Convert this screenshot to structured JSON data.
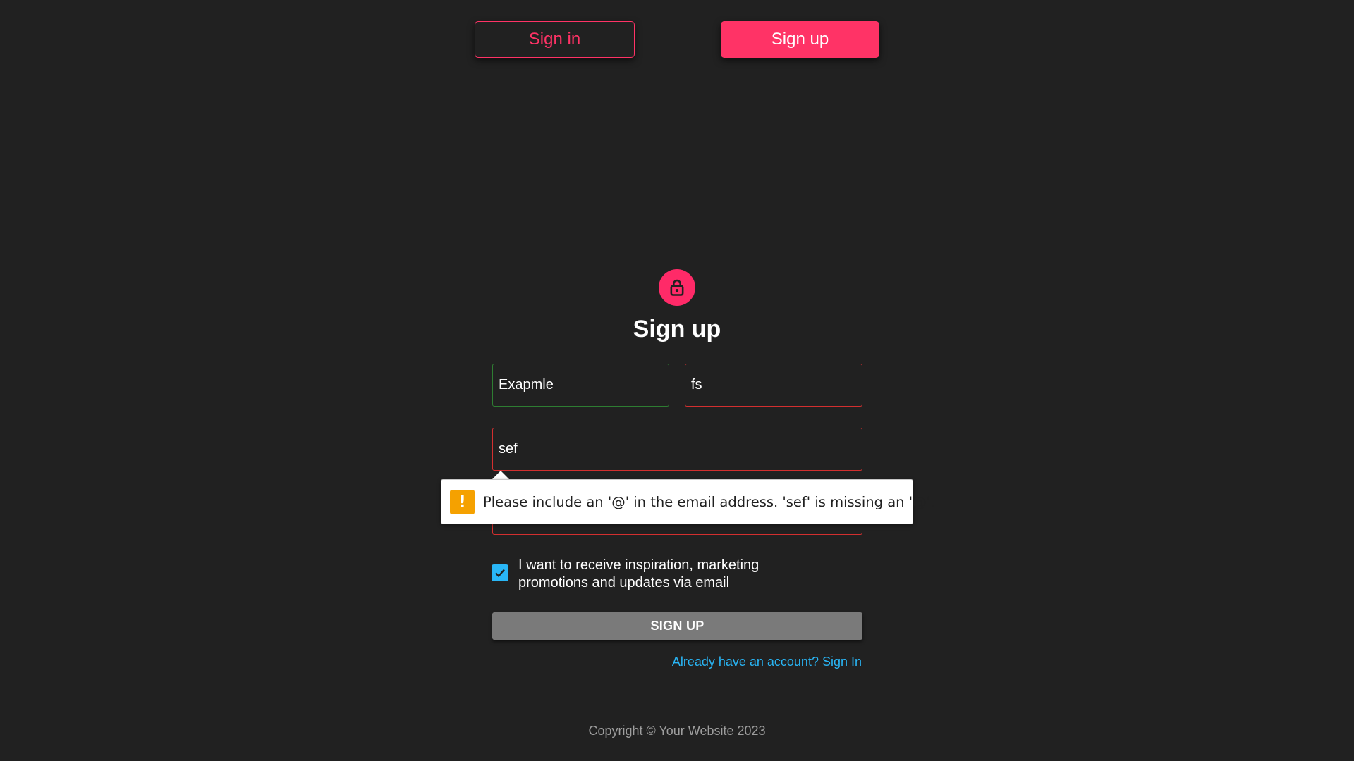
{
  "nav": {
    "signin_label": "Sign in",
    "signup_label": "Sign up"
  },
  "form": {
    "title": "Sign up",
    "first_name_value": "Exapmle",
    "last_name_value": "fs",
    "email_value": "sef",
    "password_value": "",
    "validation_message": "Please include an '@' in the email address. 'sef' is missing an '@'.",
    "consent_label": "I want to receive inspiration, marketing promotions and updates via email",
    "consent_checked": true,
    "submit_label": "SIGN UP",
    "signin_link": "Already have an account? Sign In"
  },
  "footer": {
    "copyright": "Copyright © Your Website 2023"
  },
  "colors": {
    "background": "#212121",
    "accent": "#ff3366",
    "error": "#d32f2f",
    "valid": "#2e7d32",
    "link": "#29b6f6",
    "warning": "#f5a100"
  },
  "icons": {
    "avatar": "lock-icon",
    "tooltip": "warning-icon",
    "checkbox": "check-icon"
  }
}
